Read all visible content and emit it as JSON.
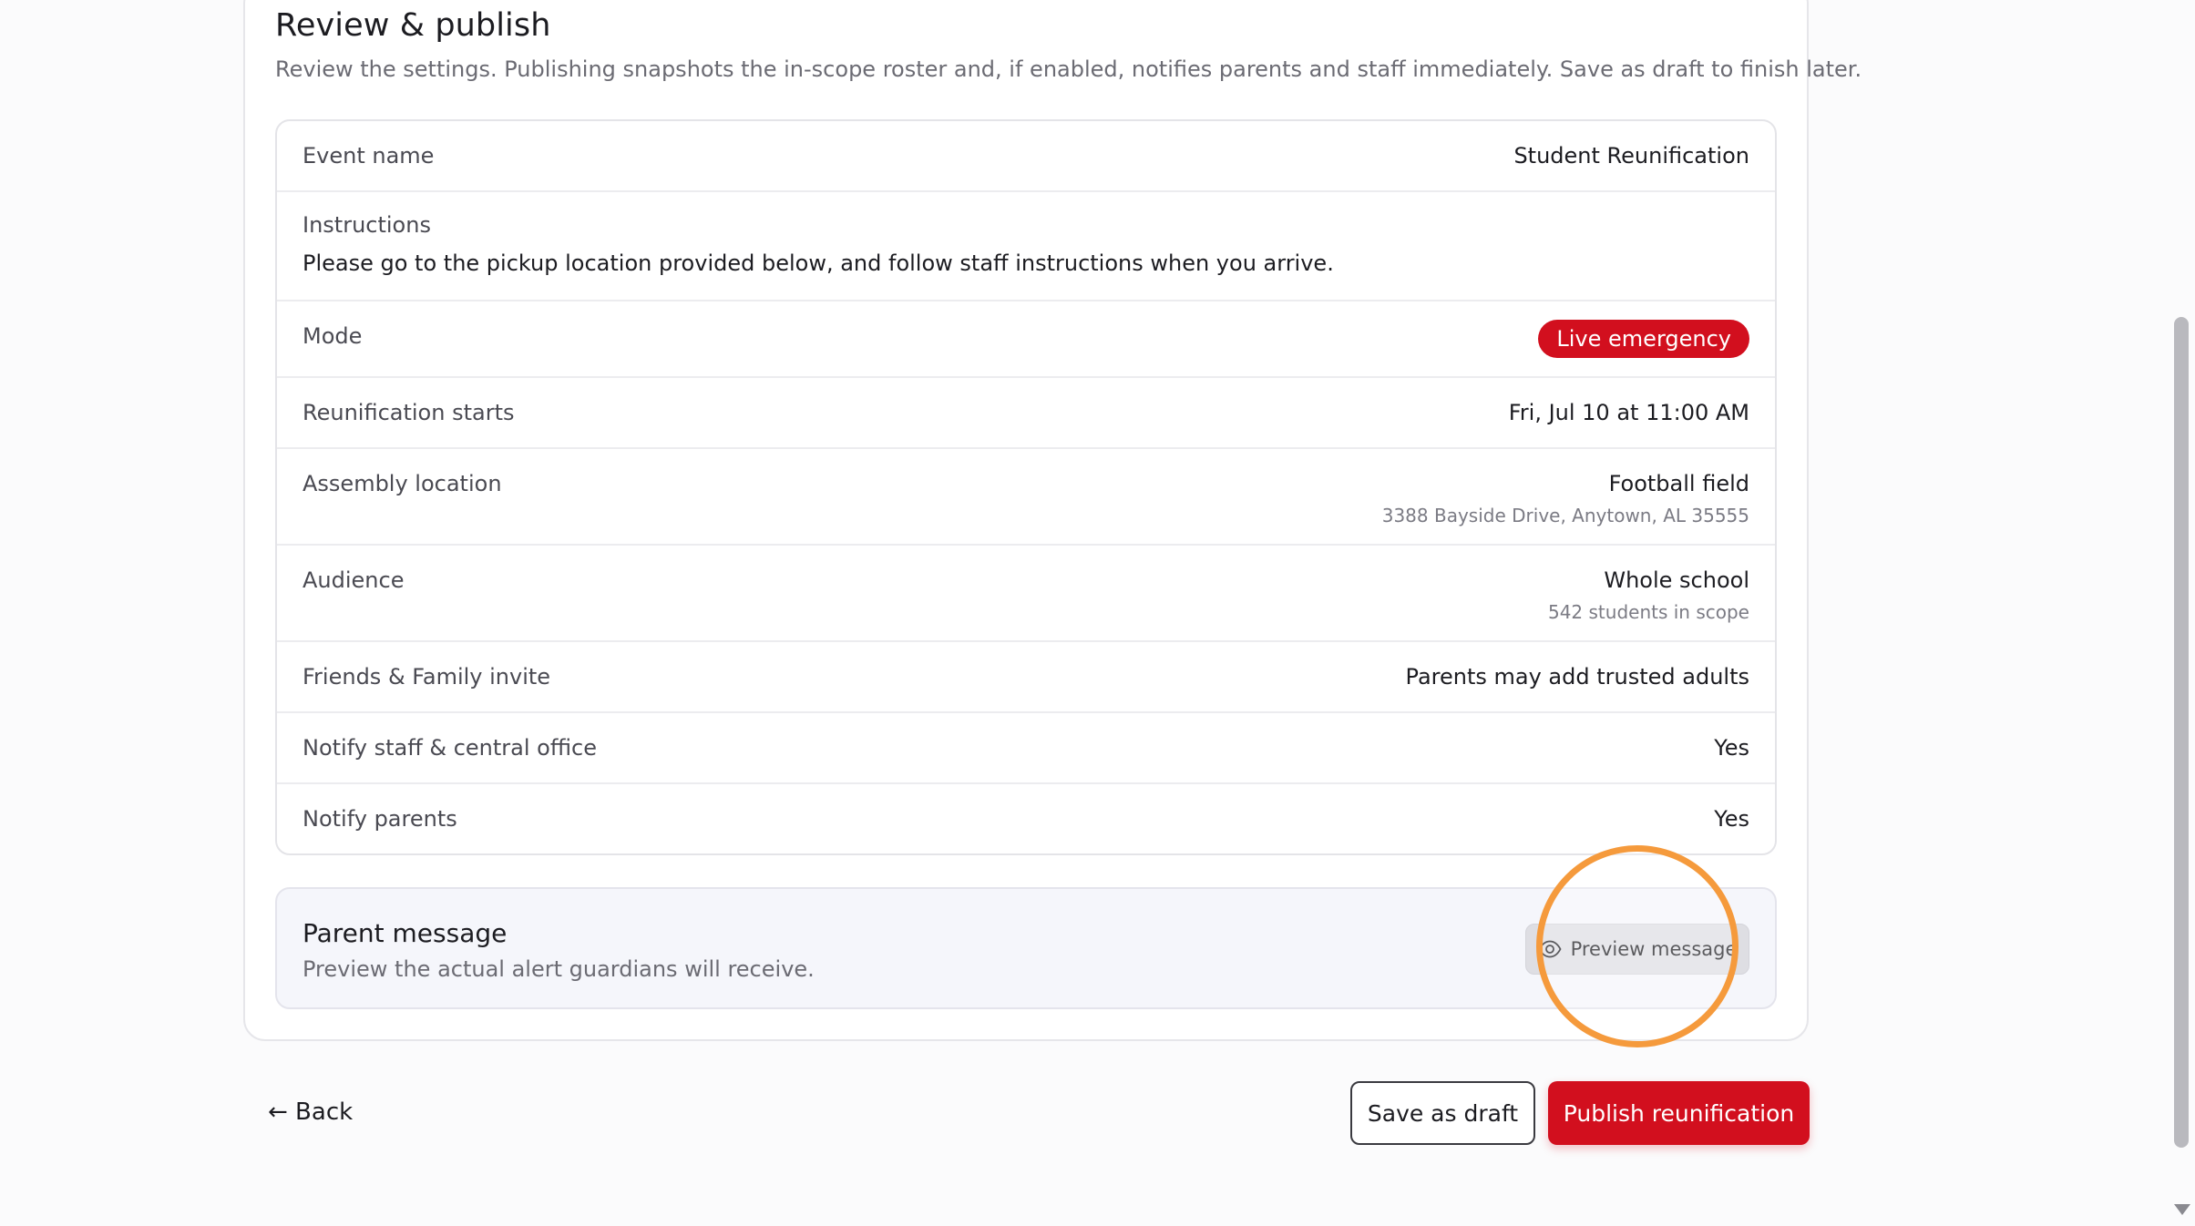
{
  "section": {
    "title": "Review & publish",
    "description": "Review the settings. Publishing snapshots the in-scope roster and, if enabled, notifies parents and staff immediately. Save as draft to finish later."
  },
  "summary": {
    "event_name": {
      "label": "Event name",
      "value": "Student Reunification"
    },
    "instructions": {
      "label": "Instructions",
      "value": "Please go to the pickup location provided below, and follow staff instructions when you arrive."
    },
    "mode": {
      "label": "Mode",
      "value": "Live emergency"
    },
    "starts": {
      "label": "Reunification starts",
      "value": "Fri, Jul 10 at 11:00 AM"
    },
    "location": {
      "label": "Assembly location",
      "value": "Football field",
      "address": "3388 Bayside Drive, Anytown, AL 35555"
    },
    "audience": {
      "label": "Audience",
      "value": "Whole school",
      "count": "542 students in scope"
    },
    "friends_family": {
      "label": "Friends & Family invite",
      "value": "Parents may add trusted adults"
    },
    "notify_staff": {
      "label": "Notify staff & central office",
      "value": "Yes"
    },
    "notify_parents": {
      "label": "Notify parents",
      "value": "Yes"
    }
  },
  "parent_message": {
    "title": "Parent message",
    "description": "Preview the actual alert guardians will receive.",
    "preview_label": "Preview message"
  },
  "footer": {
    "back_label": "← Back",
    "draft_label": "Save as draft",
    "publish_label": "Publish reunification"
  },
  "colors": {
    "accent": "#d20f1e",
    "highlight": "#f59a3c"
  }
}
